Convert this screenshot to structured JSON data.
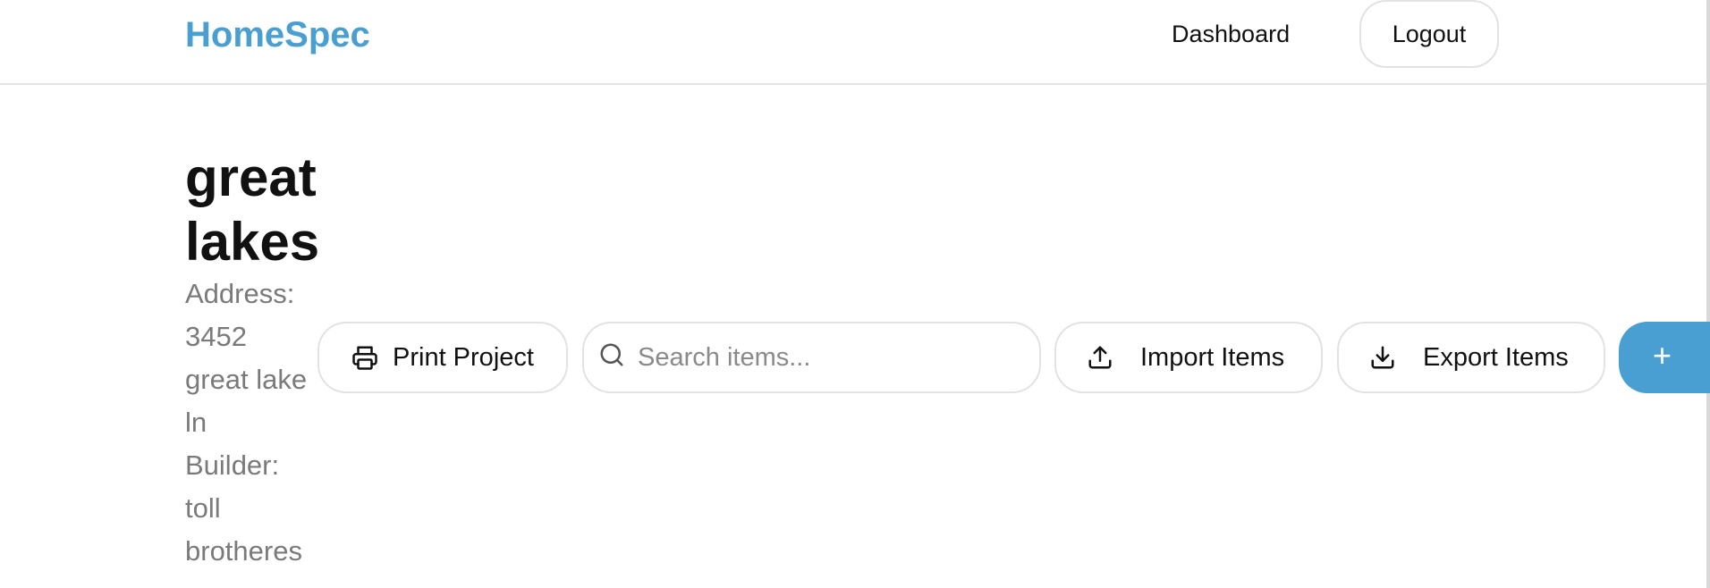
{
  "header": {
    "brand": "HomeSpec",
    "nav_dashboard": "Dashboard",
    "logout_label": "Logout"
  },
  "project": {
    "title": "great lakes",
    "address_label": "Address:",
    "address_lines": [
      "3452",
      "great lake",
      "ln"
    ],
    "builder_label": "Builder:",
    "builder_lines": [
      "toll",
      "brotheres"
    ]
  },
  "toolbar": {
    "print_label": "Print Project",
    "search_placeholder": "Search items...",
    "search_value": "",
    "import_label": "Import Items",
    "export_label": "Export Items",
    "add_label": "+"
  },
  "icons": {
    "print": "printer-icon",
    "search": "search-icon",
    "import": "upload-icon",
    "export": "download-icon",
    "add": "plus-icon"
  },
  "colors": {
    "brand": "#4a9fd2",
    "primary_button": "#4a9fd2",
    "meta_text": "#7a7a7a",
    "border": "#e2e2e2"
  }
}
